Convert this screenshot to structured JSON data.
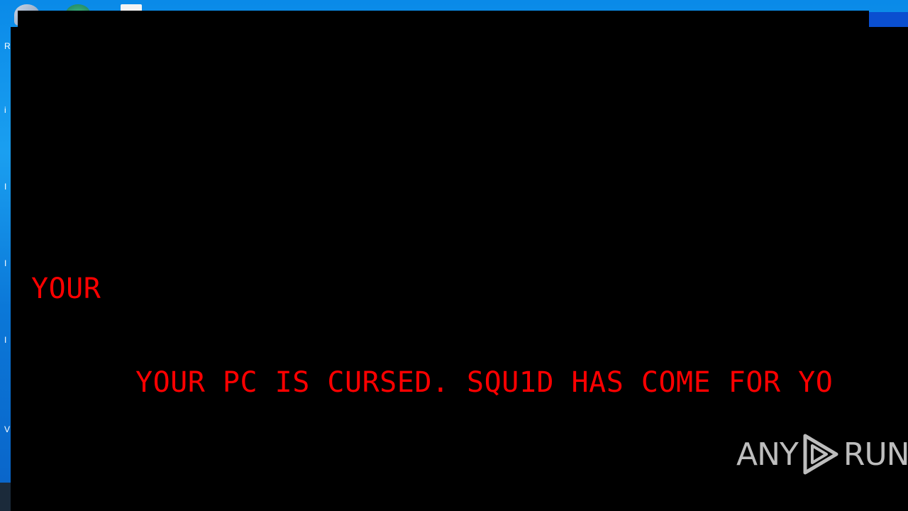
{
  "desktop": {
    "left_edge_letters": [
      "R",
      "i",
      "I",
      "I",
      "I",
      "V"
    ],
    "icons": [
      "recycle-bin-icon",
      "app-icon",
      "document-icon"
    ]
  },
  "window": {
    "line1": "YOUR",
    "line2": "YOUR PC IS CURSED. SQU1D HAS COME FOR YO",
    "text_color": "#ff0000",
    "background": "#000000"
  },
  "watermark": {
    "left": "ANY",
    "right": "RUN"
  }
}
